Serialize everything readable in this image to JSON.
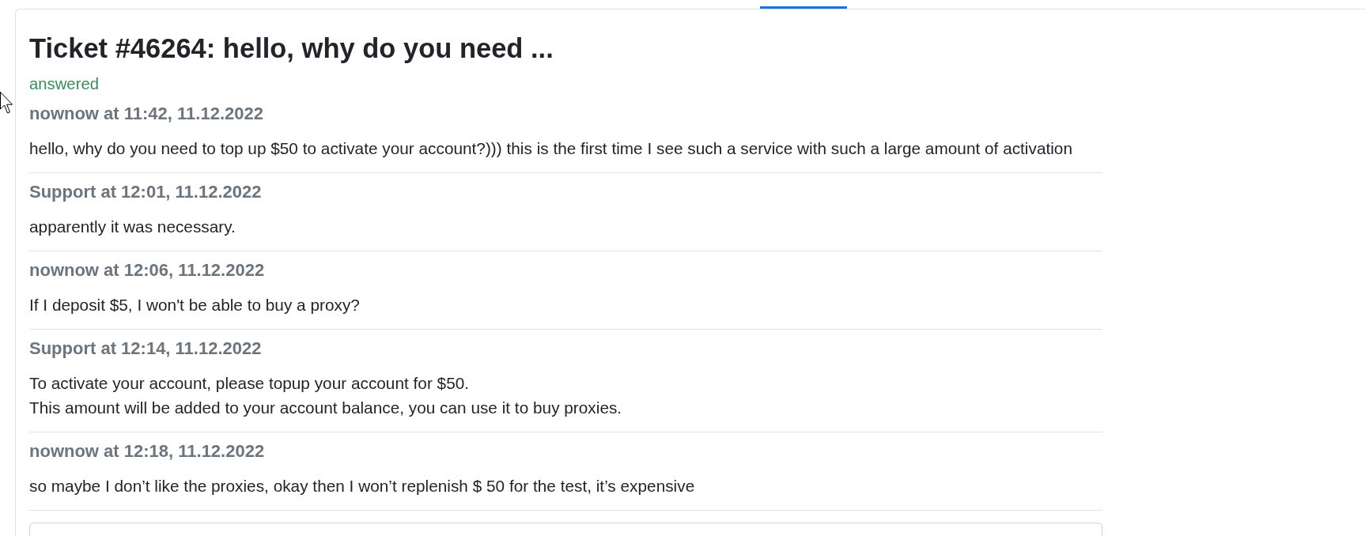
{
  "ticket": {
    "title": "Ticket #46264: hello, why do you need ...",
    "status": {
      "label": "answered",
      "kind": "answered"
    }
  },
  "messages": [
    {
      "header": "nownow at 11:42, 11.12.2022",
      "text": "hello, why do you need to top up $50 to activate your account?))) this is the first time I see such a service with such a large amount of activation"
    },
    {
      "header": "Support at 12:01, 11.12.2022",
      "text": "apparently it was necessary."
    },
    {
      "header": "nownow at 12:06, 11.12.2022",
      "text": "If I deposit $5, I won't be able to buy a proxy?"
    },
    {
      "header": "Support at 12:14, 11.12.2022",
      "text": "To activate your account, please topup your account for $50.\nThis amount will be added to your account balance, you can use it to buy proxies."
    },
    {
      "header": "nownow at 12:18, 11.12.2022",
      "text": "so maybe I don’t like the proxies, okay then I won’t replenish $ 50 for the test, it’s expensive"
    }
  ]
}
